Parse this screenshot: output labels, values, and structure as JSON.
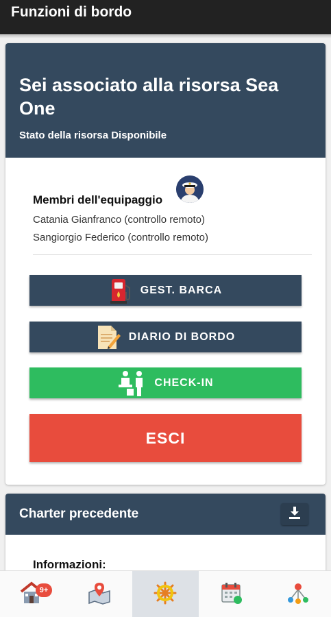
{
  "appbar": {
    "title": "Funzioni di bordo"
  },
  "resource_card": {
    "heading": "Sei associato alla risorsa Sea One",
    "status": "Stato della risorsa Disponibile"
  },
  "crew": {
    "title": "Membri dell'equipaggio",
    "members": [
      "Catania Gianfranco (controllo remoto)",
      "Sangiorgio Federico (controllo remoto)"
    ]
  },
  "actions": {
    "gest_barca": "GEST. BARCA",
    "diario": "DIARIO DI BORDO",
    "checkin": "CHECK-IN",
    "esci": "ESCI"
  },
  "charter": {
    "title": "Charter precedente",
    "info_label": "Informazioni:"
  },
  "bottom_nav": {
    "items": [
      {
        "icon": "house-icon",
        "badge": "9+"
      },
      {
        "icon": "map-pin-icon"
      },
      {
        "icon": "ship-wheel-icon",
        "active": true
      },
      {
        "icon": "calendar-icon"
      },
      {
        "icon": "network-icon"
      }
    ]
  },
  "colors": {
    "appbar": "#222222",
    "header": "#34495e",
    "checkin": "#2ebc5f",
    "esci": "#e84c3d"
  }
}
